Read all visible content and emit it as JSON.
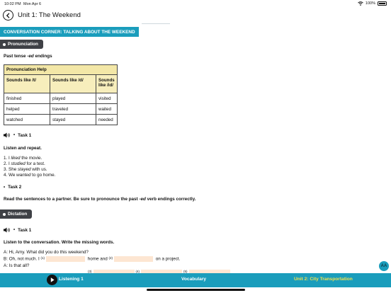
{
  "status": {
    "time": "10:02 PM",
    "date": "Mon Apr 6",
    "battery": "100%"
  },
  "header": {
    "title": "Unit 1: The Weekend"
  },
  "banner": {
    "label": "CONVERSATION CORNER: TALKING ABOUT THE WEEKEND"
  },
  "pronunciation": {
    "pill": "Pronunciation",
    "subtitle_prefix": "Past tense ",
    "subtitle_em": "-ed",
    "subtitle_suffix": " endings",
    "table": {
      "title": "Pronunciation Help",
      "headers": [
        "Sounds like /t/",
        "Sounds like /d/",
        "Sounds like /id/"
      ],
      "rows": [
        [
          "finished",
          "played",
          "visited"
        ],
        [
          "helped",
          "traveled",
          "waited"
        ],
        [
          "watched",
          "stayed",
          "needed"
        ]
      ]
    }
  },
  "task1": {
    "label": "Task 1",
    "instruction": "Listen and repeat.",
    "sentences": [
      {
        "pre": "1. I ",
        "em": "liked",
        "post": " the movie."
      },
      {
        "pre": "2. I ",
        "em": "studied",
        "post": " for a test."
      },
      {
        "pre": "3. She ",
        "em": "stayed",
        "post": " with us."
      },
      {
        "pre": "4. We ",
        "em": "wanted",
        "post": " to go home."
      }
    ]
  },
  "task2": {
    "label": "Task 2",
    "instruction_prefix": "Read the sentences to a partner. Be sure to pronounce the past ",
    "instruction_em": "-ed",
    "instruction_suffix": " verb endings correctly."
  },
  "dictation": {
    "pill": "Dictation",
    "task_label": "Task 1",
    "instruction": "Listen to the conversation. Write the missing words.",
    "line1": "A: Hi, Amy. What did you do this weekend?",
    "line2_a": "B: Oh, not much. I ",
    "line2_n1": "(1)",
    "line2_b": " home and ",
    "line2_n2": "(2)",
    "line2_c": " on a project.",
    "line3": "A: Is that all?",
    "line4_n3": "(3)",
    "line4_n4": "(4)",
    "line4_n5": "(5)"
  },
  "fab": {
    "label": "AA"
  },
  "bottom_nav": {
    "listening": "Listening 1",
    "vocabulary": "Vocabulary",
    "next_unit": "Unit 2: City Transportation"
  },
  "colors": {
    "accent": "#1a9dbc",
    "table_header": "#f3e7a7",
    "blank": "#fde6d2",
    "next_unit_text": "#f4e04d"
  }
}
